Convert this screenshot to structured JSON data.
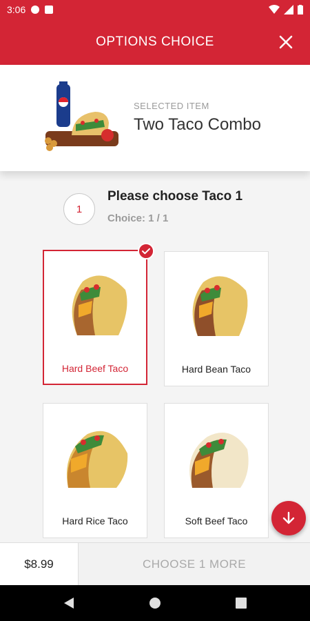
{
  "status_bar": {
    "time": "3:06"
  },
  "app_bar": {
    "title": "OPTIONS CHOICE"
  },
  "selected_item": {
    "label": "SELECTED ITEM",
    "name": "Two Taco Combo"
  },
  "choice": {
    "number": "1",
    "title": "Please choose Taco 1",
    "subtitle": "Choice: 1 / 1"
  },
  "options": [
    {
      "label": "Hard Beef Taco",
      "selected": true
    },
    {
      "label": "Hard Bean Taco",
      "selected": false
    },
    {
      "label": "Hard Rice Taco",
      "selected": false
    },
    {
      "label": "Soft Beef Taco",
      "selected": false
    }
  ],
  "bottom": {
    "price": "$8.99",
    "action": "CHOOSE 1 MORE"
  },
  "colors": {
    "accent": "#d32535",
    "muted_text": "#9a9a9a",
    "background": "#f4f4f4"
  },
  "icons": [
    "close-icon",
    "check-icon",
    "arrow-down-icon",
    "back-icon",
    "home-icon",
    "recents-icon"
  ]
}
